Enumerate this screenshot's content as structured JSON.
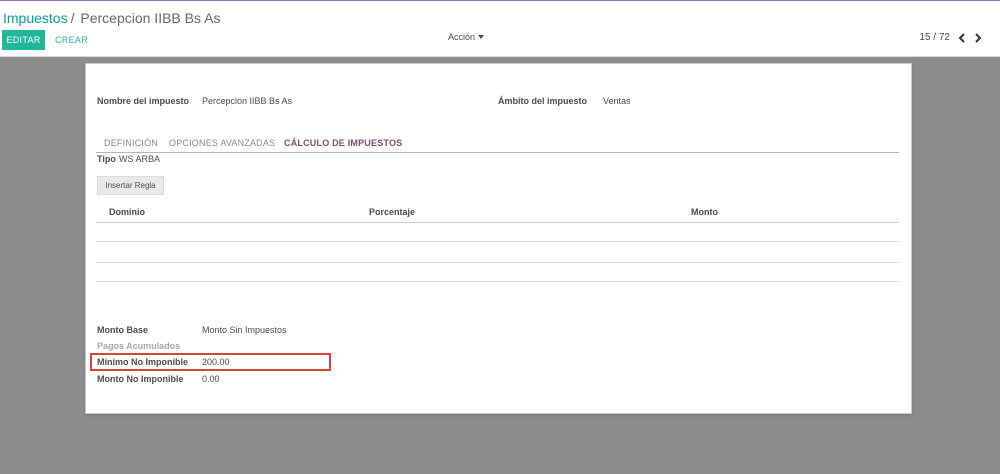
{
  "breadcrumb": {
    "parent": "Impuestos",
    "separator": "/",
    "current": "Percepcion IIBB Bs As"
  },
  "toolbar": {
    "edit_label": "EDITAR",
    "create_label": "CREAR",
    "action_label": "Acción"
  },
  "pager": {
    "value": "15 / 72"
  },
  "form": {
    "tax_name_label": "Nombre del impuesto",
    "tax_name_value": "Percepcion IIBB Bs As",
    "scope_label": "Ámbito del impuesto",
    "scope_value": "Ventas",
    "tabs": [
      {
        "label": "DEFINICIÓN",
        "active": false
      },
      {
        "label": "OPCIONES AVANZADAS",
        "active": false
      },
      {
        "label": "CÁLCULO DE IMPUESTOS",
        "active": true
      }
    ],
    "type_label": "Tipo",
    "type_value": "WS ARBA",
    "insert_rule_label": "Insertar Regla",
    "table_columns": [
      "Dominio",
      "Porcentaje",
      "Monto"
    ],
    "base_amount_label": "Monto Base",
    "base_amount_value": "Monto Sin Impuestos",
    "accumulated_payments_label": "Pagos Acumulados",
    "min_non_taxable_label": "Mínimo No Imponible",
    "min_non_taxable_value": "200.00",
    "non_taxable_amount_label": "Monto No Imponible",
    "non_taxable_amount_value": "0.00"
  },
  "colors": {
    "accent": "#21b799",
    "link": "#00a09d",
    "active_tab": "#7c4e6e",
    "highlight": "#d9442f",
    "backdrop": "#8c8c8c"
  }
}
